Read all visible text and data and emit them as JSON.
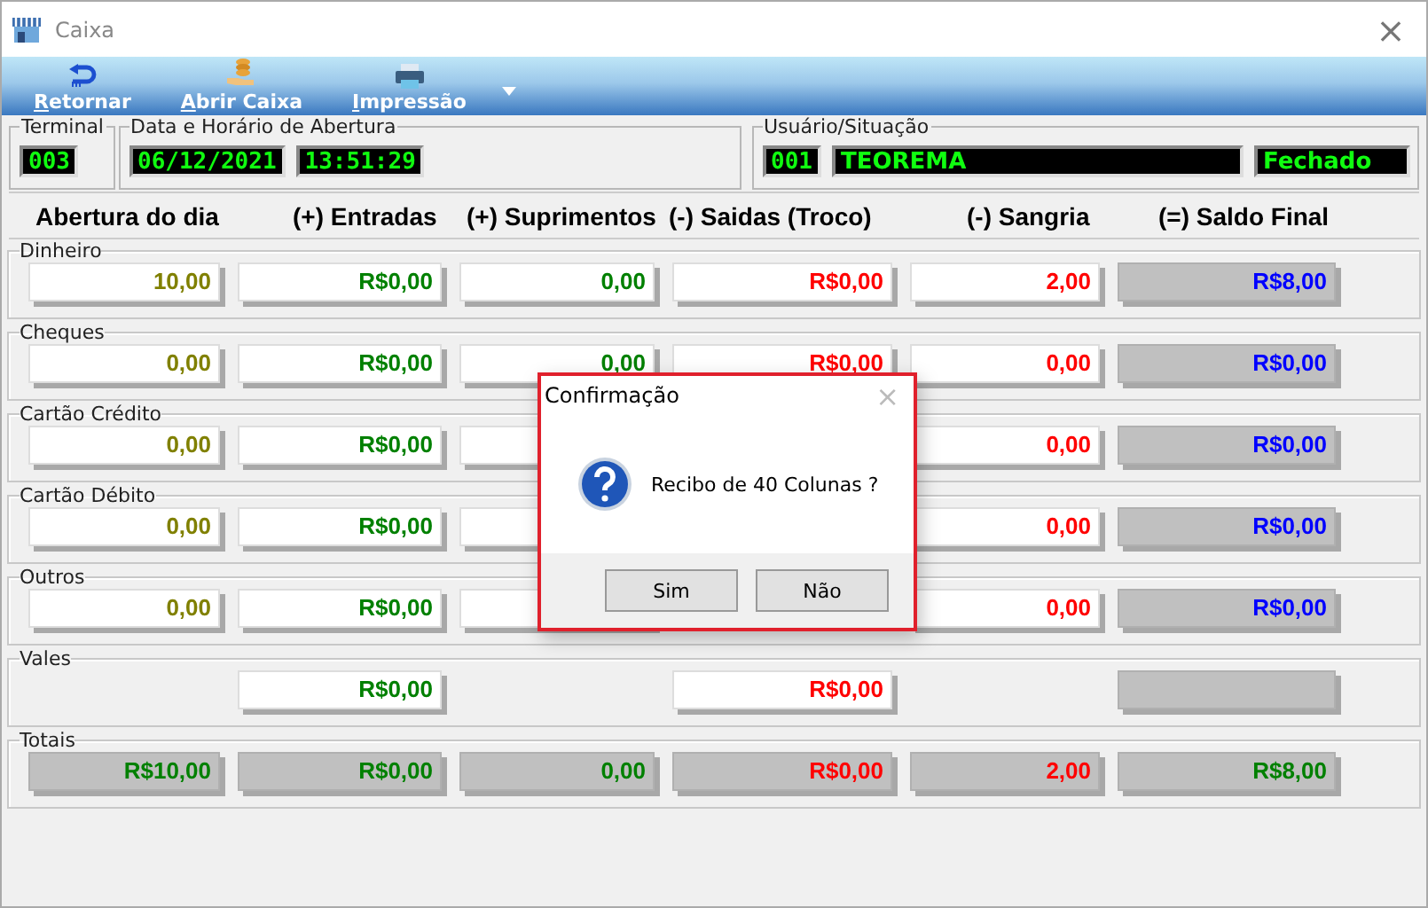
{
  "window": {
    "title": "Caixa",
    "close": "×"
  },
  "toolbar": [
    {
      "label": "Retornar",
      "mnemonic": true,
      "kind": "return"
    },
    {
      "label": "Abrir Caixa",
      "mnemonic": true,
      "kind": "coins"
    },
    {
      "label": "Impressão",
      "mnemonic": true,
      "kind": "printer"
    }
  ],
  "info": {
    "terminal": {
      "legend": "Terminal",
      "value": "003"
    },
    "opening": {
      "legend": "Data e Horário de Abertura",
      "date": "06/12/2021",
      "time": "13:51:29"
    },
    "user": {
      "legend": "Usuário/Situação",
      "id": "001",
      "name": "TEOREMA",
      "status": "Fechado"
    }
  },
  "columns": [
    "Abertura do dia",
    "(+) Entradas",
    "(+) Suprimentos",
    "(-) Saidas (Troco)",
    "(-) Sangria",
    "(=) Saldo Final"
  ],
  "groups": [
    {
      "label": "Dinheiro",
      "cells": [
        {
          "kind": "field",
          "value": "10,00",
          "color": "#808000"
        },
        {
          "kind": "field",
          "value": "R$0,00",
          "color": "#008000"
        },
        {
          "kind": "field",
          "value": "0,00",
          "color": "#008000"
        },
        {
          "kind": "field",
          "value": "R$0,00",
          "color": "#ff0000"
        },
        {
          "kind": "field",
          "value": "2,00",
          "color": "#ff0000"
        },
        {
          "kind": "readonly",
          "value": "R$8,00",
          "color": "#0000ff"
        }
      ]
    },
    {
      "label": "Cheques",
      "cells": [
        {
          "kind": "field",
          "value": "0,00",
          "color": "#808000"
        },
        {
          "kind": "field",
          "value": "R$0,00",
          "color": "#008000"
        },
        {
          "kind": "field",
          "value": "0,00",
          "color": "#008000"
        },
        {
          "kind": "field",
          "value": "R$0,00",
          "color": "#ff0000"
        },
        {
          "kind": "field",
          "value": "0,00",
          "color": "#ff0000"
        },
        {
          "kind": "readonly",
          "value": "R$0,00",
          "color": "#0000ff"
        }
      ]
    },
    {
      "label": "Cartão Crédito",
      "cells": [
        {
          "kind": "field",
          "value": "0,00",
          "color": "#808000"
        },
        {
          "kind": "field",
          "value": "R$0,00",
          "color": "#008000"
        },
        {
          "kind": "field"
        },
        null,
        {
          "kind": "field",
          "value": "0,00",
          "color": "#ff0000"
        },
        {
          "kind": "readonly",
          "value": "R$0,00",
          "color": "#0000ff"
        }
      ]
    },
    {
      "label": "Cartão Débito",
      "cells": [
        {
          "kind": "field",
          "value": "0,00",
          "color": "#808000"
        },
        {
          "kind": "field",
          "value": "R$0,00",
          "color": "#008000"
        },
        {
          "kind": "field"
        },
        null,
        {
          "kind": "field",
          "value": "0,00",
          "color": "#ff0000"
        },
        {
          "kind": "readonly",
          "value": "R$0,00",
          "color": "#0000ff"
        }
      ]
    },
    {
      "label": "Outros",
      "cells": [
        {
          "kind": "field",
          "value": "0,00",
          "color": "#808000"
        },
        {
          "kind": "field",
          "value": "R$0,00",
          "color": "#008000"
        },
        {
          "kind": "field"
        },
        null,
        {
          "kind": "field",
          "value": "0,00",
          "color": "#ff0000"
        },
        {
          "kind": "readonly",
          "value": "R$0,00",
          "color": "#0000ff"
        }
      ]
    },
    {
      "label": "Vales",
      "cells": [
        null,
        {
          "kind": "field",
          "value": "R$0,00",
          "color": "#008000"
        },
        null,
        {
          "kind": "field",
          "value": "R$0,00",
          "color": "#ff0000"
        },
        null,
        {
          "kind": "readonly"
        }
      ]
    },
    {
      "label": "Totais",
      "cells": [
        {
          "kind": "readonly",
          "value": "R$10,00",
          "color": "#008000"
        },
        {
          "kind": "readonly",
          "value": "R$0,00",
          "color": "#008000"
        },
        {
          "kind": "readonly",
          "value": "0,00",
          "color": "#008000"
        },
        {
          "kind": "readonly",
          "value": "R$0,00",
          "color": "#ff0000"
        },
        {
          "kind": "readonly",
          "value": "2,00",
          "color": "#ff0000"
        },
        {
          "kind": "readonly",
          "value": "R$8,00",
          "color": "#008000"
        }
      ]
    }
  ],
  "dialog": {
    "title": "Confirmação",
    "close": "×",
    "message": "Recibo de 40 Colunas ?",
    "buttons": [
      "Sim",
      "Não"
    ]
  }
}
